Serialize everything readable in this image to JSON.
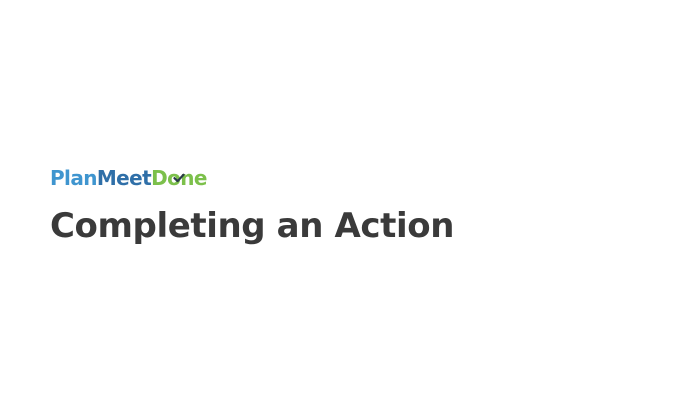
{
  "logo": {
    "part1": "Plan",
    "part2": "Meet",
    "part3a": "D",
    "part3b": "o",
    "part3c": "ne",
    "icon": "checkmark-icon",
    "colors": {
      "plan": "#3f95cf",
      "meet": "#2f6fa8",
      "done": "#7cc04b",
      "check": "#2b3a4a"
    }
  },
  "slide": {
    "title": "Completing an Action",
    "title_color": "#3a3a3a",
    "background": "#ffffff"
  }
}
